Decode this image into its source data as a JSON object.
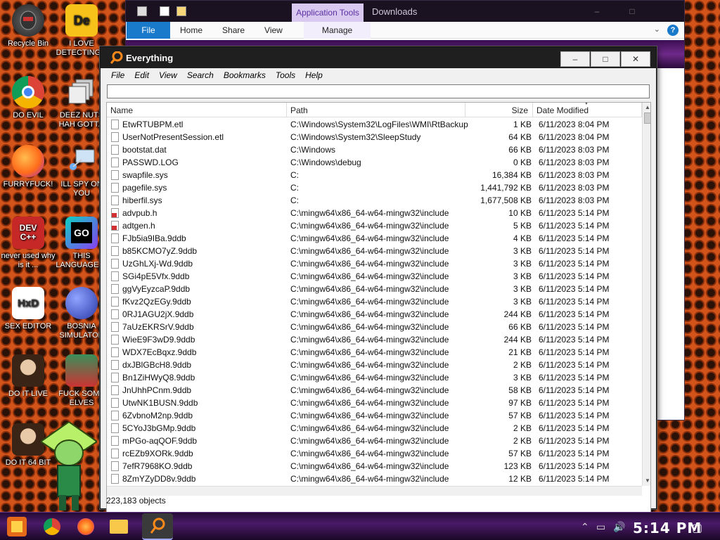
{
  "desktop": {
    "icons": [
      {
        "label": "Recycle Bin"
      },
      {
        "label": "I LOVE DETECTING..."
      },
      {
        "label": "DO EVIL"
      },
      {
        "label": "DEEZ NUTS HAH GOTT..."
      },
      {
        "label": "FURRYFUCK!"
      },
      {
        "label": "ILL SPY ON YOU"
      },
      {
        "label": "never used why is it ..."
      },
      {
        "label": "THIS LANGUAGE ..."
      },
      {
        "label": "SEX EDITOR"
      },
      {
        "label": "BOSNIA SIMULATOR"
      },
      {
        "label": "DO IT LIVE"
      },
      {
        "label": "FUCK SOME ELVES"
      },
      {
        "label": "DO IT 64 BIT"
      }
    ],
    "icon_glyphs": {
      "dev": "DEV C++",
      "go": "GO",
      "hxd": "HxD",
      "de": "De"
    }
  },
  "downloads_window": {
    "title": "Downloads",
    "app_tools": "Application Tools",
    "ribbon": {
      "file": "File",
      "home": "Home",
      "share": "Share",
      "view": "View",
      "manage": "Manage"
    },
    "help": "?",
    "minimize": "–",
    "maximize": "□"
  },
  "everything": {
    "title": "Everything",
    "controls": {
      "minimize": "–",
      "maximize": "□",
      "close": "✕"
    },
    "menu": [
      "File",
      "Edit",
      "View",
      "Search",
      "Bookmarks",
      "Tools",
      "Help"
    ],
    "search": {
      "value": "",
      "placeholder": ""
    },
    "columns": {
      "name": "Name",
      "path": "Path",
      "size": "Size",
      "date": "Date Modified"
    },
    "rows": [
      {
        "name": "EtwRTUBPM.etl",
        "path": "C:\\Windows\\System32\\LogFiles\\WMI\\RtBackup",
        "size": "1 KB",
        "date": "6/11/2023 8:04 PM",
        "icon": "file"
      },
      {
        "name": "UserNotPresentSession.etl",
        "path": "C:\\Windows\\System32\\SleepStudy",
        "size": "64 KB",
        "date": "6/11/2023 8:04 PM",
        "icon": "file"
      },
      {
        "name": "bootstat.dat",
        "path": "C:\\Windows",
        "size": "66 KB",
        "date": "6/11/2023 8:03 PM",
        "icon": "file"
      },
      {
        "name": "PASSWD.LOG",
        "path": "C:\\Windows\\debug",
        "size": "0 KB",
        "date": "6/11/2023 8:03 PM",
        "icon": "file"
      },
      {
        "name": "swapfile.sys",
        "path": "C:",
        "size": "16,384 KB",
        "date": "6/11/2023 8:03 PM",
        "icon": "sys"
      },
      {
        "name": "pagefile.sys",
        "path": "C:",
        "size": "1,441,792 KB",
        "date": "6/11/2023 8:03 PM",
        "icon": "sys"
      },
      {
        "name": "hiberfil.sys",
        "path": "C:",
        "size": "1,677,508 KB",
        "date": "6/11/2023 8:03 PM",
        "icon": "sys"
      },
      {
        "name": "advpub.h",
        "path": "C:\\mingw64\\x86_64-w64-mingw32\\include",
        "size": "10 KB",
        "date": "6/11/2023 5:14 PM",
        "icon": "h"
      },
      {
        "name": "adtgen.h",
        "path": "C:\\mingw64\\x86_64-w64-mingw32\\include",
        "size": "5 KB",
        "date": "6/11/2023 5:14 PM",
        "icon": "h"
      },
      {
        "name": "FJb5ia9IBa.9ddb",
        "path": "C:\\mingw64\\x86_64-w64-mingw32\\include",
        "size": "4 KB",
        "date": "6/11/2023 5:14 PM",
        "icon": "file"
      },
      {
        "name": "b85KCMO7yZ.9ddb",
        "path": "C:\\mingw64\\x86_64-w64-mingw32\\include",
        "size": "3 KB",
        "date": "6/11/2023 5:14 PM",
        "icon": "file"
      },
      {
        "name": "UzGhLXj-Wd.9ddb",
        "path": "C:\\mingw64\\x86_64-w64-mingw32\\include",
        "size": "3 KB",
        "date": "6/11/2023 5:14 PM",
        "icon": "file"
      },
      {
        "name": "SGi4pE5Vfx.9ddb",
        "path": "C:\\mingw64\\x86_64-w64-mingw32\\include",
        "size": "3 KB",
        "date": "6/11/2023 5:14 PM",
        "icon": "file"
      },
      {
        "name": "ggVyEyzcaP.9ddb",
        "path": "C:\\mingw64\\x86_64-w64-mingw32\\include",
        "size": "3 KB",
        "date": "6/11/2023 5:14 PM",
        "icon": "file"
      },
      {
        "name": "fKvz2QzEGy.9ddb",
        "path": "C:\\mingw64\\x86_64-w64-mingw32\\include",
        "size": "3 KB",
        "date": "6/11/2023 5:14 PM",
        "icon": "file"
      },
      {
        "name": "0RJ1AGU2jX.9ddb",
        "path": "C:\\mingw64\\x86_64-w64-mingw32\\include",
        "size": "244 KB",
        "date": "6/11/2023 5:14 PM",
        "icon": "file"
      },
      {
        "name": "7aUzEKRSrV.9ddb",
        "path": "C:\\mingw64\\x86_64-w64-mingw32\\include",
        "size": "66 KB",
        "date": "6/11/2023 5:14 PM",
        "icon": "file"
      },
      {
        "name": "WieE9F3wD9.9ddb",
        "path": "C:\\mingw64\\x86_64-w64-mingw32\\include",
        "size": "244 KB",
        "date": "6/11/2023 5:14 PM",
        "icon": "file"
      },
      {
        "name": "WDX7EcBqxz.9ddb",
        "path": "C:\\mingw64\\x86_64-w64-mingw32\\include",
        "size": "21 KB",
        "date": "6/11/2023 5:14 PM",
        "icon": "file"
      },
      {
        "name": "dxJBlGBcH8.9ddb",
        "path": "C:\\mingw64\\x86_64-w64-mingw32\\include",
        "size": "2 KB",
        "date": "6/11/2023 5:14 PM",
        "icon": "file"
      },
      {
        "name": "Bn1ZiHWyQ8.9ddb",
        "path": "C:\\mingw64\\x86_64-w64-mingw32\\include",
        "size": "3 KB",
        "date": "6/11/2023 5:14 PM",
        "icon": "file"
      },
      {
        "name": "JnUhhPCnm.9ddb",
        "path": "C:\\mingw64\\x86_64-w64-mingw32\\include",
        "size": "58 KB",
        "date": "6/11/2023 5:14 PM",
        "icon": "file"
      },
      {
        "name": "UtwNK1BUSN.9ddb",
        "path": "C:\\mingw64\\x86_64-w64-mingw32\\include",
        "size": "97 KB",
        "date": "6/11/2023 5:14 PM",
        "icon": "file"
      },
      {
        "name": "6ZvbnoM2np.9ddb",
        "path": "C:\\mingw64\\x86_64-w64-mingw32\\include",
        "size": "57 KB",
        "date": "6/11/2023 5:14 PM",
        "icon": "file"
      },
      {
        "name": "5CYoJ3bGMp.9ddb",
        "path": "C:\\mingw64\\x86_64-w64-mingw32\\include",
        "size": "2 KB",
        "date": "6/11/2023 5:14 PM",
        "icon": "file"
      },
      {
        "name": "mPGo-aqQOF.9ddb",
        "path": "C:\\mingw64\\x86_64-w64-mingw32\\include",
        "size": "2 KB",
        "date": "6/11/2023 5:14 PM",
        "icon": "file"
      },
      {
        "name": "rcEZb9XORk.9ddb",
        "path": "C:\\mingw64\\x86_64-w64-mingw32\\include",
        "size": "57 KB",
        "date": "6/11/2023 5:14 PM",
        "icon": "file"
      },
      {
        "name": "7efR7968KO.9ddb",
        "path": "C:\\mingw64\\x86_64-w64-mingw32\\include",
        "size": "123 KB",
        "date": "6/11/2023 5:14 PM",
        "icon": "file"
      },
      {
        "name": "8ZmYZyDD8v.9ddb",
        "path": "C:\\mingw64\\x86_64-w64-mingw32\\include",
        "size": "12 KB",
        "date": "6/11/2023 5:14 PM",
        "icon": "file"
      }
    ],
    "status": "223,183 objects"
  },
  "taskbar": {
    "clock": "5:14 PM",
    "items": [
      "start-button",
      "chrome",
      "firefox",
      "file-explorer",
      "everything"
    ]
  },
  "colors": {
    "accent": "#1979ca",
    "taskbar": "#4a1a68",
    "desktop": "#d2541a"
  }
}
